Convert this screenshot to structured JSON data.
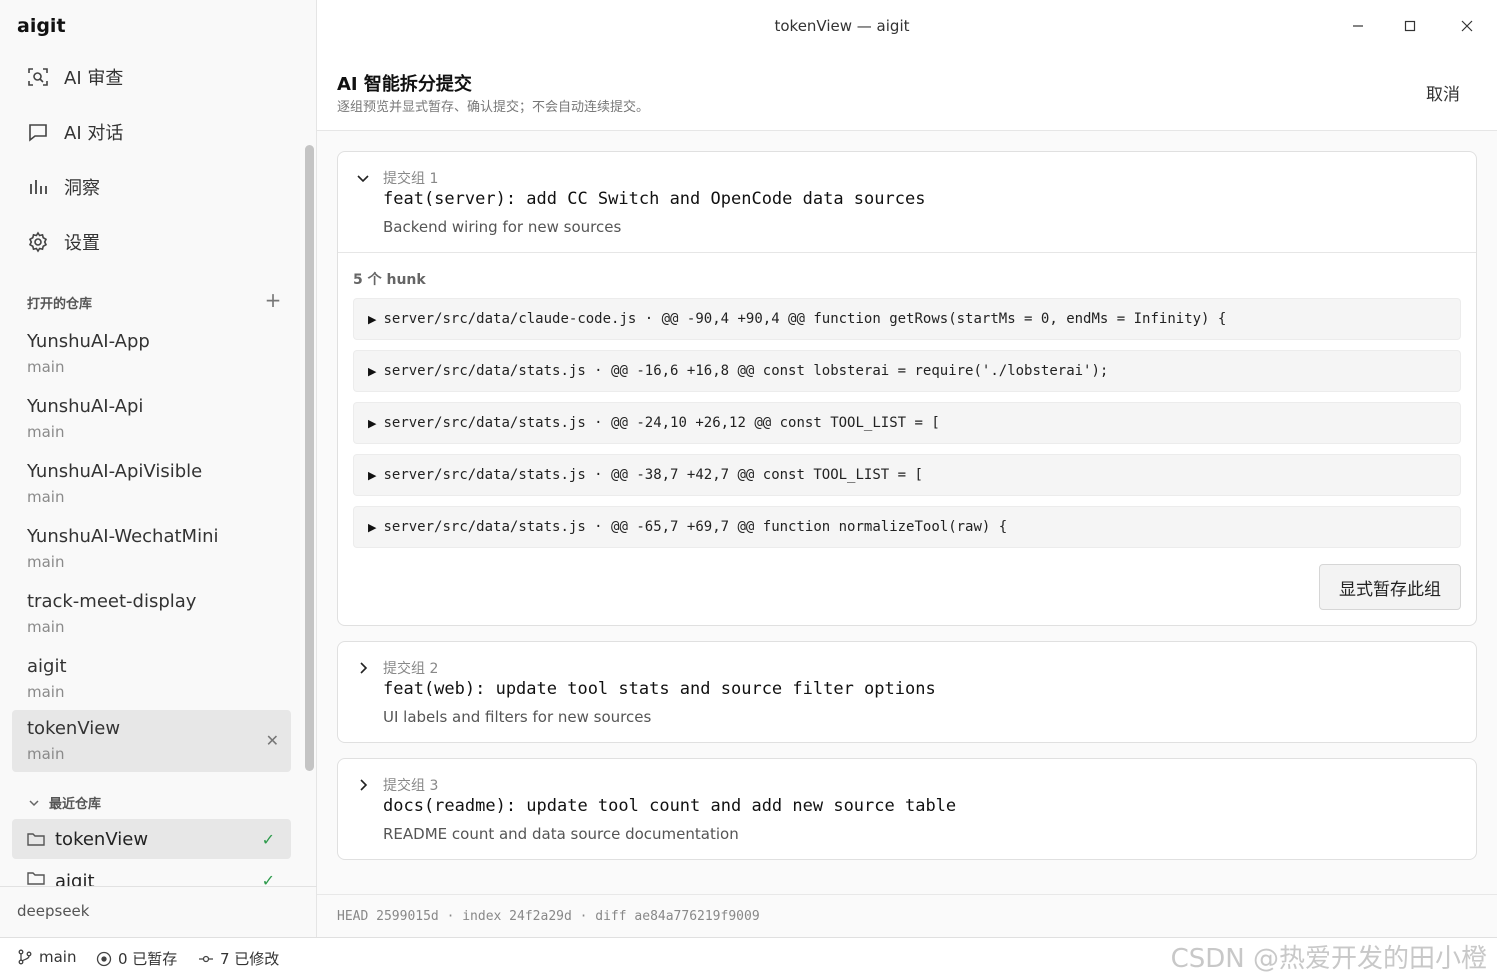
{
  "app": {
    "name": "aigit",
    "window_title": "tokenView — aigit"
  },
  "nav": [
    {
      "label": "AI 审查",
      "icon": "scan-icon"
    },
    {
      "label": "AI 对话",
      "icon": "chat-icon"
    },
    {
      "label": "洞察",
      "icon": "bar-chart-icon"
    },
    {
      "label": "设置",
      "icon": "gear-icon"
    }
  ],
  "open_repos": {
    "heading": "打开的仓库",
    "items": [
      {
        "name": "YunshuAI-App",
        "branch": "main"
      },
      {
        "name": "YunshuAI-Api",
        "branch": "main"
      },
      {
        "name": "YunshuAI-ApiVisible",
        "branch": "main"
      },
      {
        "name": "YunshuAI-WechatMini",
        "branch": "main"
      },
      {
        "name": "track-meet-display",
        "branch": "main"
      },
      {
        "name": "aigit",
        "branch": "main"
      },
      {
        "name": "tokenView",
        "branch": "main",
        "active": true
      }
    ]
  },
  "recent_repos": {
    "heading": "最近仓库",
    "items": [
      {
        "name": "tokenView"
      },
      {
        "name": "aigit"
      }
    ]
  },
  "model": "deepseek",
  "header": {
    "title": "AI 智能拆分提交",
    "subtitle": "逐组预览并显式暂存、确认提交；不会自动连续提交。",
    "cancel": "取消"
  },
  "groups": [
    {
      "label": "提交组 1",
      "title": "feat(server): add CC Switch and OpenCode data sources",
      "desc": "Backend wiring for new sources",
      "expanded": true,
      "hunk_count": "5 个 hunk",
      "hunks": [
        "server/src/data/claude-code.js · @@ -90,4 +90,4 @@ function getRows(startMs = 0, endMs = Infinity) {",
        "server/src/data/stats.js · @@ -16,6 +16,8 @@ const lobsterai = require('./lobsterai');",
        "server/src/data/stats.js · @@ -24,10 +26,12 @@ const TOOL_LIST = [",
        "server/src/data/stats.js · @@ -38,7 +42,7 @@ const TOOL_LIST = [",
        "server/src/data/stats.js · @@ -65,7 +69,7 @@ function normalizeTool(raw) {"
      ],
      "stage_button": "显式暂存此组"
    },
    {
      "label": "提交组 2",
      "title": "feat(web): update tool stats and source filter options",
      "desc": "UI labels and filters for new sources",
      "expanded": false
    },
    {
      "label": "提交组 3",
      "title": "docs(readme): update tool count and add new source table",
      "desc": "README count and data source documentation",
      "expanded": false
    }
  ],
  "footer_hash": "HEAD 2599015d · index 24f2a29d · diff ae84a776219f9009",
  "statusbar": {
    "branch": "main",
    "staged": "0 已暂存",
    "modified": "7 已修改",
    "watermark": "CSDN @热爱开发的田小橙"
  }
}
